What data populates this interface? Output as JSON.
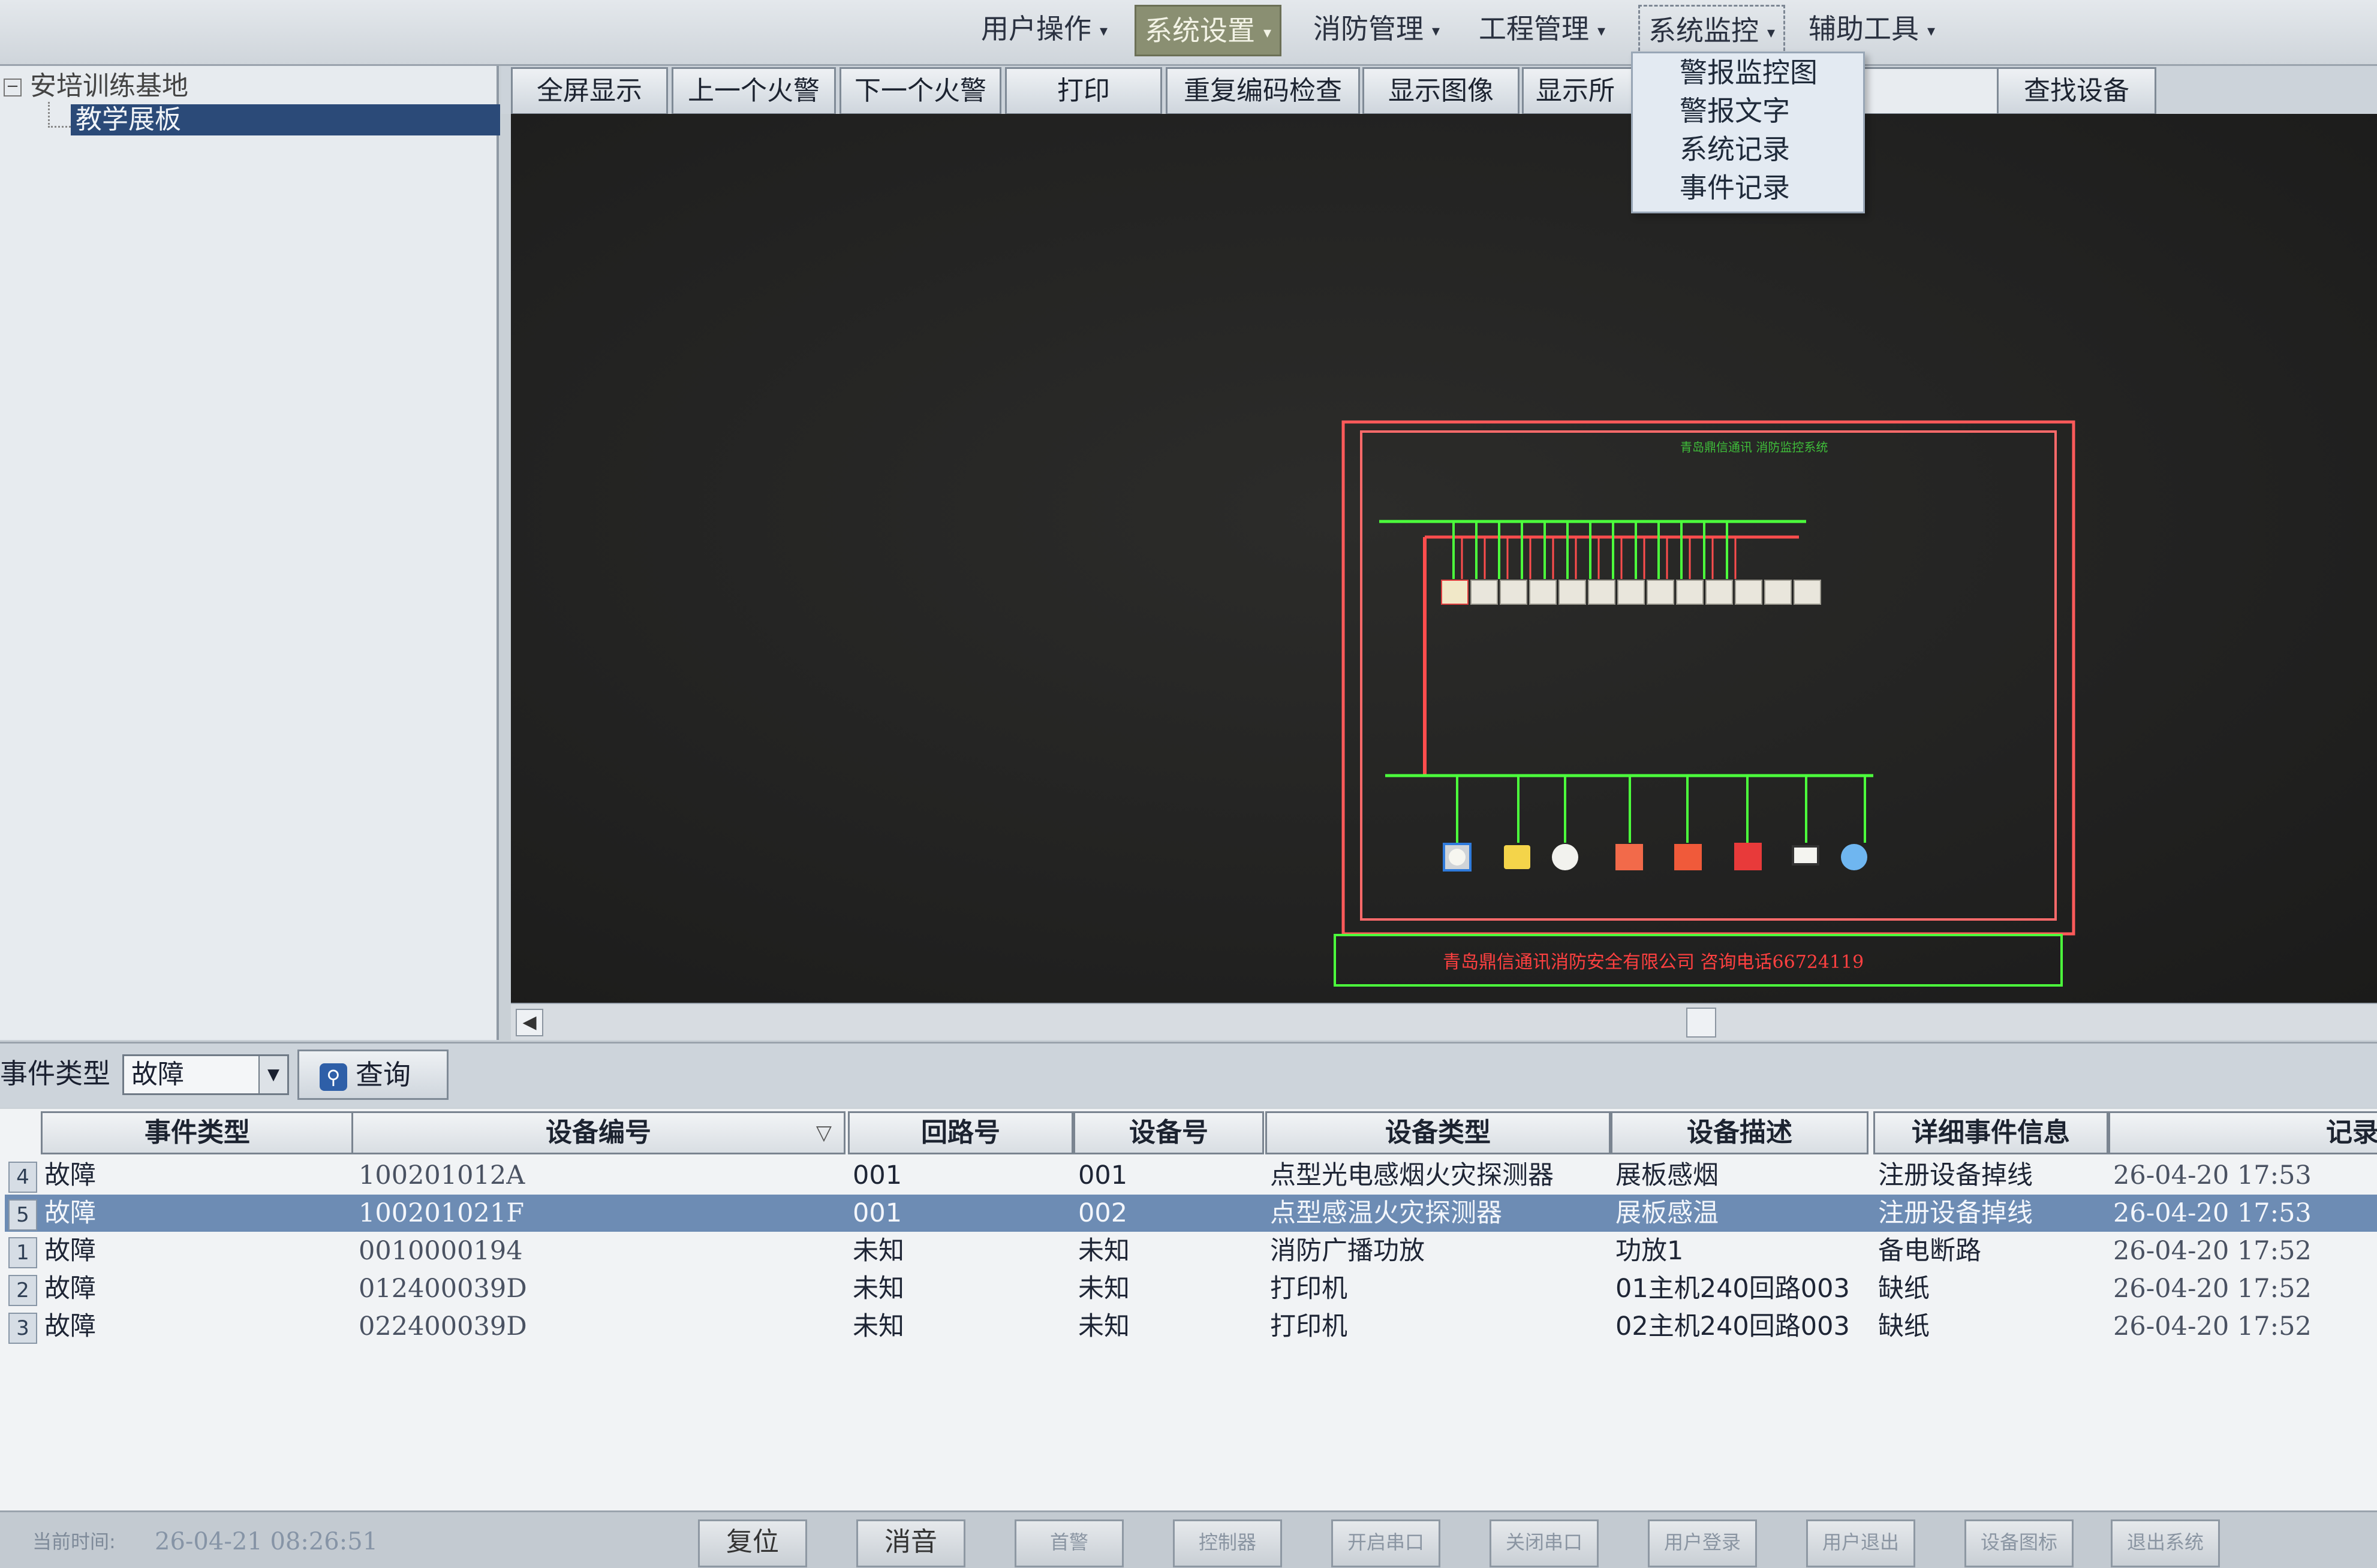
{
  "menubar": {
    "items": [
      {
        "label": "用户操作"
      },
      {
        "label": "系统设置"
      },
      {
        "label": "消防管理"
      },
      {
        "label": "工程管理"
      },
      {
        "label": "系统监控"
      },
      {
        "label": "辅助工具"
      }
    ]
  },
  "dropdown": {
    "items": [
      "警报监控图",
      "警报文字",
      "系统记录",
      "事件记录"
    ]
  },
  "tree": {
    "root": "安培训练基地",
    "child": "教学展板"
  },
  "toolbar": {
    "buttons": [
      "全屏显示",
      "上一个火警",
      "下一个火警",
      "打印",
      "重复编码检查",
      "显示图像",
      "显示所",
      "查找设备"
    ]
  },
  "diagram": {
    "panel_title": "青岛鼎信通讯 消防监控系统",
    "footer_text": "青岛鼎信通讯消防安全有限公司  咨询电话66724119",
    "colors": {
      "frame": "#ff5a5a",
      "bus": "#4cff3c",
      "module": "#e9e6dc"
    }
  },
  "filter": {
    "label": "事件类型",
    "selected": "故障",
    "query_button": "查询"
  },
  "table": {
    "columns": [
      "事件类型",
      "设备编号",
      "回路号",
      "设备号",
      "设备类型",
      "设备描述",
      "详细事件信息",
      "记录"
    ],
    "rows": [
      {
        "num": "4",
        "type": "故障",
        "code": "100201012A",
        "loop": "001",
        "dev": "001",
        "dtype": "点型光电感烟火灾探测器",
        "desc": "展板感烟",
        "info": "注册设备掉线",
        "time": "26-04-20  17:53"
      },
      {
        "num": "5",
        "type": "故障",
        "code": "100201021F",
        "loop": "001",
        "dev": "002",
        "dtype": "点型感温火灾探测器",
        "desc": "展板感温",
        "info": "注册设备掉线",
        "time": "26-04-20  17:53"
      },
      {
        "num": "1",
        "type": "故障",
        "code": "0010000194",
        "loop": "未知",
        "dev": "未知",
        "dtype": "消防广播功放",
        "desc": "功放1",
        "info": "备电断路",
        "time": "26-04-20  17:52"
      },
      {
        "num": "2",
        "type": "故障",
        "code": "012400039D",
        "loop": "未知",
        "dev": "未知",
        "dtype": "打印机",
        "desc": "01主机240回路003",
        "info": "缺纸",
        "time": "26-04-20  17:52"
      },
      {
        "num": "3",
        "type": "故障",
        "code": "022400039D",
        "loop": "未知",
        "dev": "未知",
        "dtype": "打印机",
        "desc": "02主机240回路003",
        "info": "缺纸",
        "time": "26-04-20  17:52"
      }
    ],
    "selected_row": 1
  },
  "statusbar": {
    "time_label": "当前时间:",
    "time_value": "26-04-21  08:26:51",
    "buttons": [
      "复位",
      "消音",
      "首警",
      "控制器",
      "开启串口",
      "关闭串口",
      "用户登录",
      "用户退出",
      "设备图标",
      "退出系统"
    ]
  }
}
